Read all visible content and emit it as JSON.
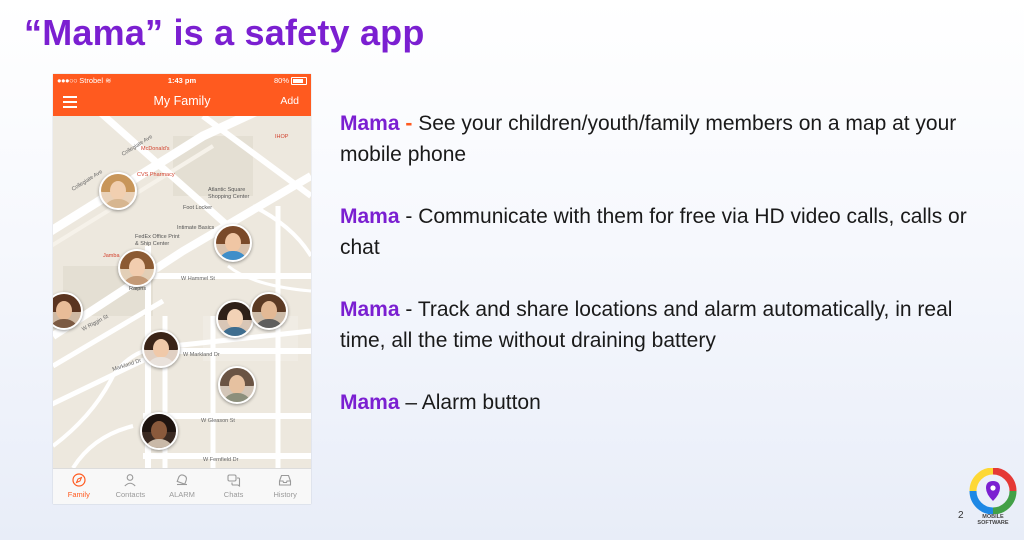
{
  "slide": {
    "title": "“Mama” is a safety app",
    "page_number": "2"
  },
  "phone": {
    "status": {
      "carrier": "Strobel",
      "time": "1:43 pm",
      "battery": "80%"
    },
    "header": {
      "title": "My Family",
      "add_label": "Add"
    },
    "map_labels": {
      "collegiate_ave": "Collegiate Ave",
      "collegiate_ave_2": "Collegiate Ave",
      "mcdonalds": "McDonald's",
      "cvs": "CVS Pharmacy",
      "ihop": "IHOP",
      "atlantic_square": "Atlantic Square",
      "shopping_center": "Shopping Center",
      "foot_locker": "Foot Locker",
      "intimate_basics": "Intimate Basics",
      "fedex": "FedEx Office Print",
      "ship_center": "& Ship Center",
      "jamba": "Jamba",
      "w_hammel": "W Hammel St",
      "ralphs": "Ralphs",
      "w_riggin": "W Riggin St",
      "markland_dr": "Markland Dr",
      "w_markland_dr": "W Markland Dr",
      "w_gleason": "W Gleason St",
      "w_fernfield": "W Fernfield Dr"
    },
    "tabs": [
      {
        "label": "Family",
        "icon": "compass-icon",
        "active": true
      },
      {
        "label": "Contacts",
        "icon": "person-icon",
        "active": false
      },
      {
        "label": "ALARM",
        "icon": "alarm-icon",
        "active": false
      },
      {
        "label": "Chats",
        "icon": "chat-bubbles-icon",
        "active": false
      },
      {
        "label": "History",
        "icon": "inbox-icon",
        "active": false
      }
    ]
  },
  "bullets": [
    {
      "keyword": "Mama",
      "separator": " - ",
      "text": "See your children/youth/family members on a map at your mobile phone"
    },
    {
      "keyword": "Mama",
      "separator": " - ",
      "text": "Communicate with them for free via HD video calls, calls or chat"
    },
    {
      "keyword": "Mama",
      "separator": " - ",
      "text": "Track and share locations and alarm automatically, in real time, all the time without draining battery"
    },
    {
      "keyword": "Mama",
      "separator": " – ",
      "text": "Alarm button"
    }
  ],
  "logo": {
    "line1": "MOBILE",
    "line2": "SOFTWARE"
  },
  "colors": {
    "accent_purple": "#7b1fd1",
    "app_orange": "#ff5a1f",
    "map_bg": "#ede8de"
  }
}
